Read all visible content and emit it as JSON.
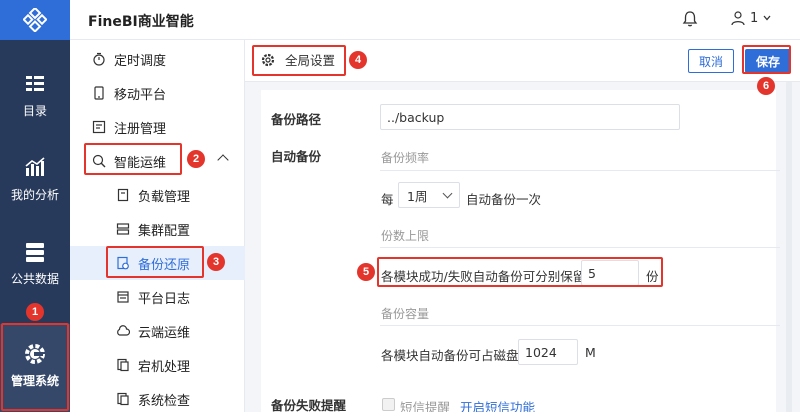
{
  "rail": {
    "items": [
      {
        "label": "目录",
        "icon": "catalog-icon"
      },
      {
        "label": "我的分析",
        "icon": "chart-icon"
      },
      {
        "label": "公共数据",
        "icon": "database-icon"
      },
      {
        "label": "管理系统",
        "icon": "gear-icon"
      }
    ]
  },
  "header": {
    "title": "FineBI商业智能",
    "user_count": "1"
  },
  "nav": {
    "items": [
      {
        "label": "定时调度"
      },
      {
        "label": "移动平台"
      },
      {
        "label": "注册管理"
      },
      {
        "label": "智能运维"
      },
      {
        "label": "负载管理"
      },
      {
        "label": "集群配置"
      },
      {
        "label": "备份还原"
      },
      {
        "label": "平台日志"
      },
      {
        "label": "云端运维"
      },
      {
        "label": "宕机处理"
      },
      {
        "label": "系统检查"
      }
    ]
  },
  "badges": [
    "1",
    "2",
    "3",
    "4",
    "5",
    "6"
  ],
  "content": {
    "tab_label": "全局设置",
    "cancel_label": "取消",
    "save_label": "保存",
    "backup_path_label": "备份路径",
    "backup_path_value": "../backup",
    "auto_backup_label": "自动备份",
    "frequency_label": "备份频率",
    "every_label": "每",
    "frequency_value": "1周",
    "frequency_suffix": "自动备份一次",
    "count_limit_label": "份数上限",
    "count_text": "各模块成功/失败自动备份可分别保留",
    "count_value": "5",
    "count_unit": "份",
    "capacity_label": "备份容量",
    "capacity_text": "各模块自动备份可占磁盘",
    "capacity_value": "1024",
    "capacity_unit": "M",
    "fail_alert_label": "备份失败提醒",
    "sms_label": "短信提醒",
    "sms_link": "开启短信功能"
  },
  "colors": {
    "rail_bg": "#283a5b",
    "brand_blue": "#2f6ed8",
    "annotation_red": "#e3352b"
  }
}
